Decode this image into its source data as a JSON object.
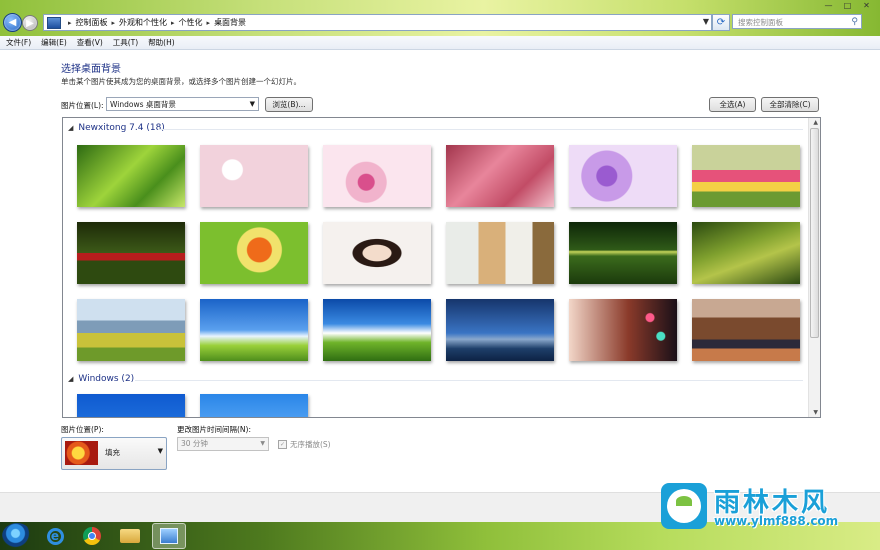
{
  "window": {
    "breadcrumb": [
      "控制面板",
      "外观和个性化",
      "个性化",
      "桌面背景"
    ],
    "search_placeholder": "搜索控制面板",
    "controls": {
      "minimize": "—",
      "maximize": "□",
      "close": "✕"
    }
  },
  "menu": [
    "文件(F)",
    "编辑(E)",
    "查看(V)",
    "工具(T)",
    "帮助(H)"
  ],
  "page": {
    "title": "选择桌面背景",
    "description": "单击某个图片使其成为您的桌面背景，或选择多个图片创建一个幻灯片。",
    "location_label": "图片位置(L):",
    "location_value": "Windows 桌面背景",
    "browse_button": "浏览(B)...",
    "select_all_button": "全选(A)",
    "clear_all_button": "全部清除(C)"
  },
  "gallery": {
    "groups": [
      {
        "label": "Newxitong 7.4 (18)"
      },
      {
        "label": "Windows (2)"
      }
    ],
    "tiles": [
      {
        "name": "green-leaves-thumbnail",
        "bg": "linear-gradient(135deg,#2d6a12,#9ed43b 45%,#4a8f1c 70%,#c8e86a)"
      },
      {
        "name": "white-cherry-blossom-thumbnail",
        "bg": "radial-gradient(circle at 30% 40%,#fff 0 10px,#f2d2dc 11px),linear-gradient(#f6e6ea,#e7c2cd)"
      },
      {
        "name": "pink-blossom-thumbnail",
        "bg": "radial-gradient(circle at 40% 60%,#d94f8c 0 8px,#f1b3cc 9px 20px,#fbe5ee 21px)"
      },
      {
        "name": "pink-flowers-branch-thumbnail",
        "bg": "linear-gradient(135deg,#a2354c,#e8859b 40%,#c24c66 70%,#f2c1cc)"
      },
      {
        "name": "purple-flowers-thumbnail",
        "bg": "radial-gradient(circle at 35% 50%,#9a5bd0 0 10px,#c89ae8 11px 25px,#eedcf7 26px)"
      },
      {
        "name": "tulip-field-thumbnail",
        "bg": "linear-gradient(#c9d29a 0 40%,#e6527a 40% 60%,#f4d045 60% 75%,#6b9a32 75%)"
      },
      {
        "name": "red-tulips-thumbnail",
        "bg": "linear-gradient(#1d2a08,#3c5a18 50%,#b71d1d 50% 62%,#2e4a10 62%)"
      },
      {
        "name": "orange-lantern-thumbnail",
        "bg": "radial-gradient(circle at 55% 45%,#ef6b1a 0 12px,#f1e26c 13px 22px,#7cbf2e 23px)"
      },
      {
        "name": "girl-portrait-thumbnail",
        "bg": "radial-gradient(ellipse at 50% 50%,#f3dccb 0 14px,#2a1a14 15px 24px,#f5f1ee 25px)"
      },
      {
        "name": "girl-scarf-thumbnail",
        "bg": "linear-gradient(90deg,#e9ece8 0 30%,#d9b07a 30% 55%,#f0efe9 55% 80%,#8a6a3c 80%)"
      },
      {
        "name": "bicycle-garden-thumbnail",
        "bg": "linear-gradient(#0e2608,#2f5a18 45%,#c4d45a 48%,#3b6b1c 55%,#1b3a0c)"
      },
      {
        "name": "green-hills-thumbnail",
        "bg": "linear-gradient(160deg,#2b4a10,#7fa02e 40%,#b4c44a 60%,#2c4a12)"
      },
      {
        "name": "mountain-meadow-thumbnail",
        "bg": "linear-gradient(#cfe0ef 0 35%,#7e9cb8 35% 55%,#c9c23a 55% 78%,#6e9a2a 78%)"
      },
      {
        "name": "blue-sky-grass-thumbnail",
        "bg": "linear-gradient(#1b63c8,#5aa0ee 50%,#e8f4ff 60%,#9ad03a 75%,#4e8e1c)"
      },
      {
        "name": "clouds-field-thumbnail",
        "bg": "linear-gradient(#0b4aa8,#3a8ae2 40%,#ffffff 55%,#6fb42a 70%,#2f6e12)"
      },
      {
        "name": "blue-sky-sea-thumbnail",
        "bg": "linear-gradient(#16356c,#3a74c4 55%,#8aa8cc 65%,#1e3f6a 80%,#0d2244)"
      },
      {
        "name": "bokeh-cup-thumbnail",
        "bg": "radial-gradient(circle at 75% 30%,#ff5a8a 0 4px,transparent 5px),radial-gradient(circle at 85% 60%,#4adfc4 0 4px,transparent 5px),linear-gradient(90deg,#f2d6c8,#8a3a2a 55%,#1a1018)"
      },
      {
        "name": "sea-rock-sunset-thumbnail",
        "bg": "linear-gradient(#c8a892 0 30%,#7a4a2e 30% 65%,#2c2a3a 65% 80%,#c77a4a 80%)"
      },
      {
        "name": "windows-blue-thumbnail",
        "bg": "linear-gradient(#0f5ad0,#2f86ea)"
      },
      {
        "name": "daisy-sky-thumbnail",
        "bg": "radial-gradient(circle at 40% 55%,#fff 0 5px,transparent 6px),linear-gradient(#2a86e8,#7cc0ff)"
      }
    ]
  },
  "options": {
    "position_label": "图片位置(P):",
    "position_value": "填充",
    "interval_label": "更改图片时间间隔(N):",
    "interval_value": "30 分钟",
    "shuffle_label": "无序播放(S)"
  },
  "watermark": {
    "title": "雨林木风",
    "url": "www.ylmf888.com"
  },
  "taskbar": {
    "apps": [
      "internet-explorer",
      "chrome",
      "file-explorer",
      "control-panel"
    ]
  }
}
